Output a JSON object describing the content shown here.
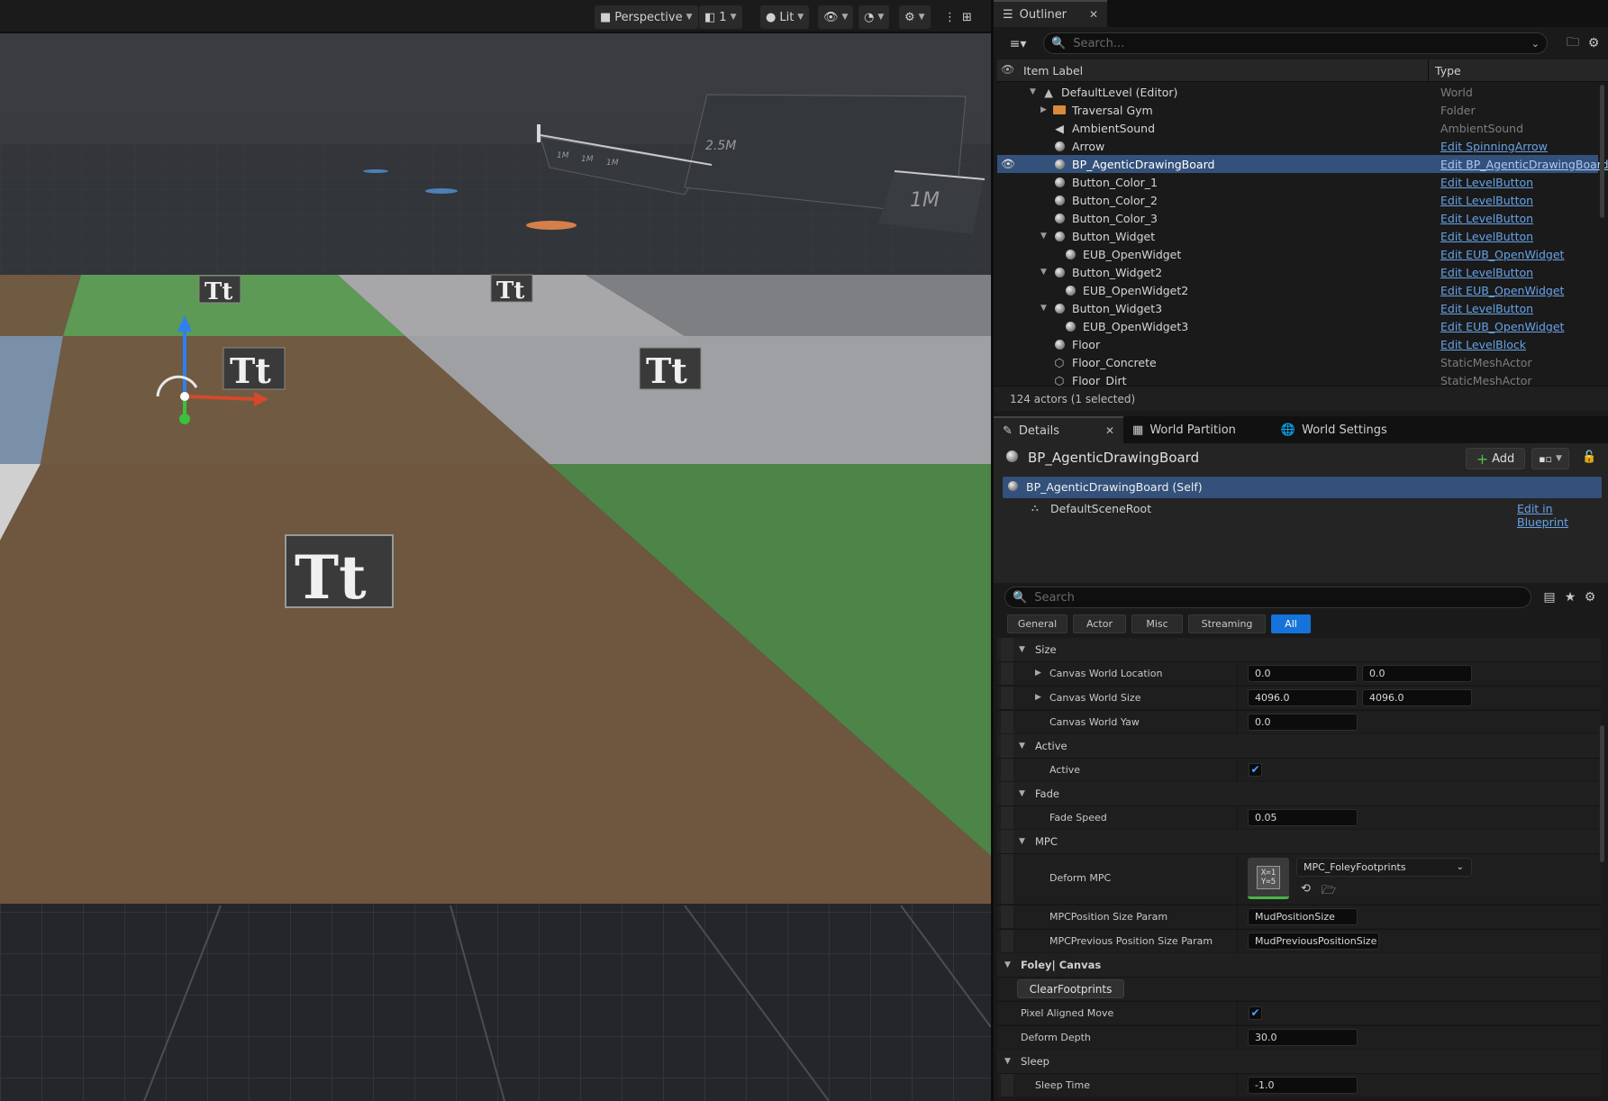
{
  "viewport": {
    "toolbar": {
      "perspective": "Perspective",
      "cameras": "1",
      "lit": "Lit"
    },
    "labels": {
      "m25": "2.5M",
      "m1": "1M",
      "m1a": "1M",
      "m1b": "1M",
      "m1c": "1M"
    },
    "text_actor_glyph": "Tt"
  },
  "outliner": {
    "tab_title": "Outliner",
    "search_placeholder": "Search...",
    "col_label": "Item Label",
    "col_type": "Type",
    "rows": [
      {
        "label": "DefaultLevel (Editor)",
        "type": "World"
      },
      {
        "label": "Traversal Gym",
        "type": "Folder"
      },
      {
        "label": "AmbientSound",
        "type": "AmbientSound"
      },
      {
        "label": "Arrow",
        "type": "Edit SpinningArrow"
      },
      {
        "label": "BP_AgenticDrawingBoard",
        "type": "Edit BP_AgenticDrawingBoard"
      },
      {
        "label": "Button_Color_1",
        "type": "Edit LevelButton"
      },
      {
        "label": "Button_Color_2",
        "type": "Edit LevelButton"
      },
      {
        "label": "Button_Color_3",
        "type": "Edit LevelButton"
      },
      {
        "label": "Button_Widget",
        "type": "Edit LevelButton"
      },
      {
        "label": "EUB_OpenWidget",
        "type": "Edit EUB_OpenWidget"
      },
      {
        "label": "Button_Widget2",
        "type": "Edit LevelButton"
      },
      {
        "label": "EUB_OpenWidget2",
        "type": "Edit EUB_OpenWidget"
      },
      {
        "label": "Button_Widget3",
        "type": "Edit LevelButton"
      },
      {
        "label": "EUB_OpenWidget3",
        "type": "Edit EUB_OpenWidget"
      },
      {
        "label": "Floor",
        "type": "Edit LevelBlock"
      },
      {
        "label": "Floor_Concrete",
        "type": "StaticMeshActor"
      },
      {
        "label": "Floor_Dirt",
        "type": "StaticMeshActor"
      }
    ],
    "status": "124 actors (1 selected)"
  },
  "tabs": {
    "details": "Details",
    "world_partition": "World Partition",
    "world_settings": "World Settings"
  },
  "details": {
    "actor_name": "BP_AgenticDrawingBoard",
    "add_label": "Add",
    "self_label": "BP_AgenticDrawingBoard (Self)",
    "scene_root": "DefaultSceneRoot",
    "edit_in_blueprint": "Edit in Blueprint",
    "search_placeholder": "Search",
    "categories": [
      "General",
      "Actor",
      "Misc",
      "Streaming",
      "All"
    ],
    "sections": {
      "size": "Size",
      "active": "Active",
      "fade": "Fade",
      "mpc": "MPC",
      "foley_canvas": "Foley| Canvas",
      "sleep": "Sleep"
    },
    "props": {
      "canvas_world_location": {
        "name": "Canvas World Location",
        "x": "0.0",
        "y": "0.0"
      },
      "canvas_world_size": {
        "name": "Canvas World Size",
        "x": "4096.0",
        "y": "4096.0"
      },
      "canvas_world_yaw": {
        "name": "Canvas World Yaw",
        "value": "0.0"
      },
      "active": {
        "name": "Active"
      },
      "fade_speed": {
        "name": "Fade Speed",
        "value": "0.05"
      },
      "deform_mpc": {
        "name": "Deform MPC",
        "value": "MPC_FoleyFootprints",
        "thumb": "X=1 Y=5"
      },
      "mpc_position_size_param": {
        "name": "MPCPosition Size Param",
        "value": "MudPositionSize"
      },
      "mpc_previous_position_size_param": {
        "name": "MPCPrevious Position Size Param",
        "value": "MudPreviousPositionSize"
      },
      "clear_footprints": "ClearFootprints",
      "pixel_aligned_move": {
        "name": "Pixel Aligned Move"
      },
      "deform_depth": {
        "name": "Deform Depth",
        "value": "30.0"
      },
      "sleep_time": {
        "name": "Sleep Time",
        "value": "-1.0"
      }
    }
  }
}
